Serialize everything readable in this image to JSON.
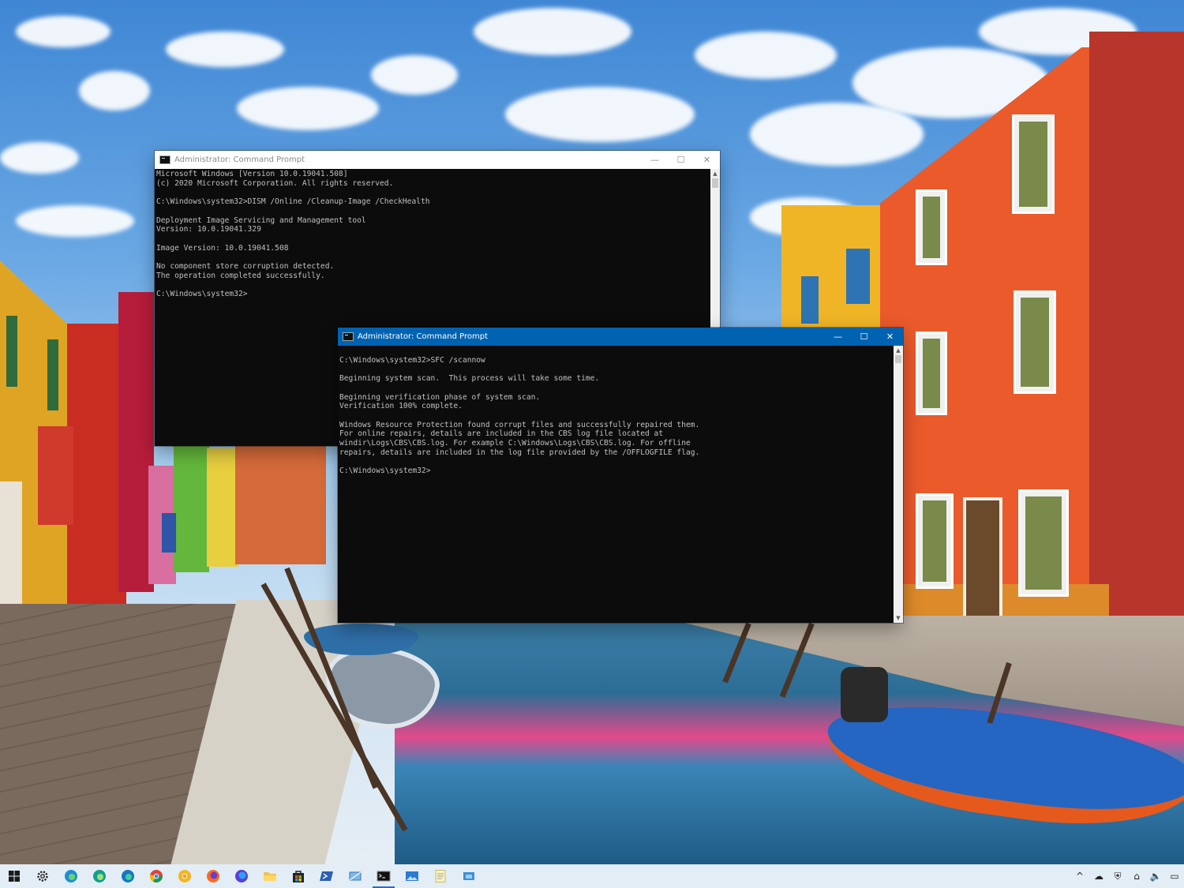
{
  "desktop": {
    "wallpaper": "canal-street-photo"
  },
  "windows": {
    "back": {
      "title": "Administrator: Command Prompt",
      "focused": false,
      "console_lines": [
        "Microsoft Windows [Version 10.0.19041.508]",
        "(c) 2020 Microsoft Corporation. All rights reserved.",
        "",
        "C:\\Windows\\system32>DISM /Online /Cleanup-Image /CheckHealth",
        "",
        "Deployment Image Servicing and Management tool",
        "Version: 10.0.19041.329",
        "",
        "Image Version: 10.0.19041.508",
        "",
        "No component store corruption detected.",
        "The operation completed successfully.",
        "",
        "C:\\Windows\\system32>"
      ],
      "buttons": {
        "minimize": "—",
        "maximize": "☐",
        "close": "✕"
      }
    },
    "front": {
      "title": "Administrator: Command Prompt",
      "focused": true,
      "console_lines": [
        "",
        "C:\\Windows\\system32>SFC /scannow",
        "",
        "Beginning system scan.  This process will take some time.",
        "",
        "Beginning verification phase of system scan.",
        "Verification 100% complete.",
        "",
        "Windows Resource Protection found corrupt files and successfully repaired them.",
        "For online repairs, details are included in the CBS log file located at",
        "windir\\Logs\\CBS\\CBS.log. For example C:\\Windows\\Logs\\CBS\\CBS.log. For offline",
        "repairs, details are included in the log file provided by the /OFFLOGFILE flag.",
        "",
        "C:\\Windows\\system32>"
      ],
      "buttons": {
        "minimize": "—",
        "maximize": "☐",
        "close": "✕"
      }
    }
  },
  "colors": {
    "focused_titlebar": "#0063b1",
    "console_background": "#0c0c0c",
    "console_text": "#c0c0c0"
  },
  "taskbar": {
    "pinned": [
      {
        "icon": "windows-start-icon",
        "active": false
      },
      {
        "icon": "settings-gear-icon",
        "active": false
      },
      {
        "icon": "edge-icon",
        "active": false
      },
      {
        "icon": "edge-beta-icon",
        "active": false
      },
      {
        "icon": "edge-dev-icon",
        "active": false
      },
      {
        "icon": "chrome-icon",
        "active": false
      },
      {
        "icon": "chrome-canary-icon",
        "active": false
      },
      {
        "icon": "firefox-icon",
        "active": false
      },
      {
        "icon": "firefox-nightly-icon",
        "active": false
      },
      {
        "icon": "file-explorer-icon",
        "active": false
      },
      {
        "icon": "store-icon",
        "active": false
      },
      {
        "icon": "powershell-icon",
        "active": false
      },
      {
        "icon": "remote-desktop-icon",
        "active": false
      },
      {
        "icon": "command-prompt-icon",
        "active": true
      },
      {
        "icon": "photos-icon",
        "active": false
      },
      {
        "icon": "notepad-icon",
        "active": false
      },
      {
        "icon": "virtual-machine-icon",
        "active": false
      }
    ],
    "tray": [
      {
        "icon": "chevron-up-icon",
        "glyph": "^"
      },
      {
        "icon": "onedrive-cloud-icon",
        "glyph": "☁"
      },
      {
        "icon": "security-shield-icon",
        "glyph": "⛨"
      },
      {
        "icon": "network-icon",
        "glyph": "⌂"
      },
      {
        "icon": "volume-icon",
        "glyph": "🔈"
      },
      {
        "icon": "action-center-icon",
        "glyph": "▭"
      }
    ]
  }
}
